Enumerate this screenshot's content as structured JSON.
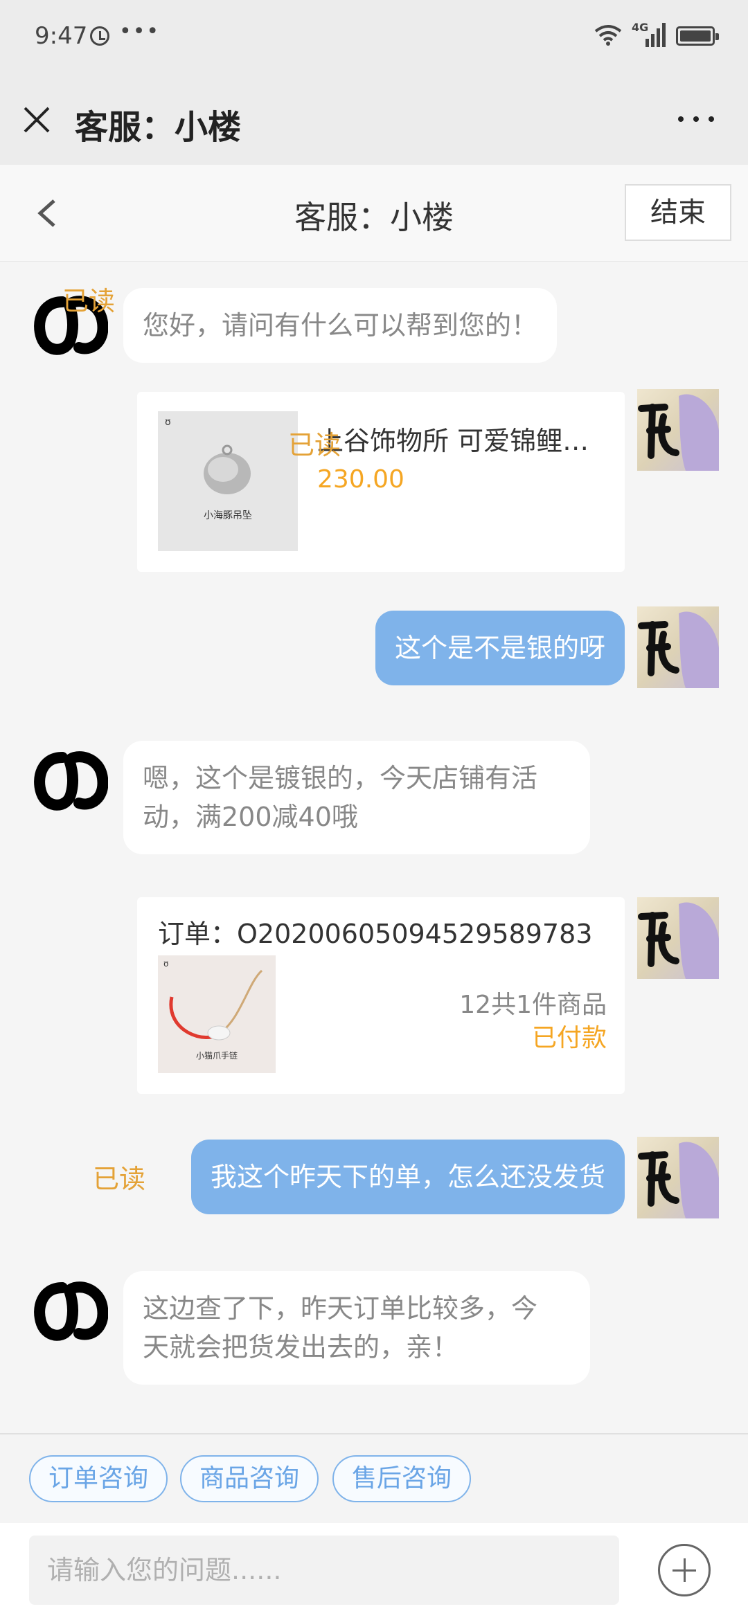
{
  "status_bar": {
    "time": "9:47",
    "dots": "•••",
    "network": "4G"
  },
  "outer_header": {
    "title": "客服：小楼"
  },
  "chat_header": {
    "title": "客服：小楼",
    "end_label": "结束"
  },
  "messages": {
    "m1": {
      "text": "您好，请问有什么可以帮到您的！"
    },
    "m2": {
      "read": "已读",
      "product_title": "上谷饰物所 可爱锦鲤海...",
      "price": "230.00",
      "thumb_caption": "小海豚吊坠"
    },
    "m3": {
      "read": "已读",
      "text": "这个是不是银的呀"
    },
    "m4": {
      "text_line1": "嗯，这个是镀银的，今天店铺有活",
      "text_line2": "动，满200减40哦"
    },
    "m5": {
      "order_no": "订单：O20200605094529589783",
      "count": "12共1件商品",
      "status": "已付款",
      "thumb_caption": "小猫爪手链"
    },
    "m6": {
      "read": "已读",
      "text": "我这个昨天下的单，怎么还没发货"
    },
    "m7": {
      "text_line1": "这边查了下，昨天订单比较多，今",
      "text_line2": "天就会把货发出去的，亲！"
    }
  },
  "quick_tags": [
    "订单咨询",
    "商品咨询",
    "售后咨询"
  ],
  "input": {
    "placeholder": "请输入您的问题......"
  },
  "colors": {
    "accent_blue": "#7fb3ea",
    "read_orange": "#e4a237",
    "price_orange": "#f5a623"
  }
}
